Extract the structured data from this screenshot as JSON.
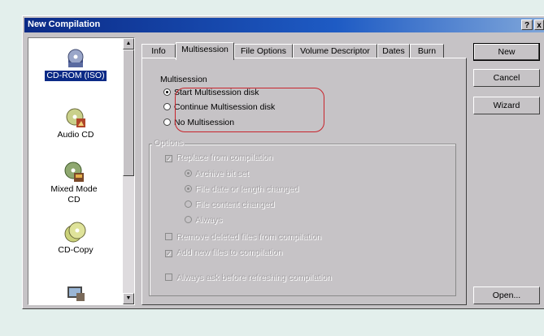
{
  "window": {
    "title": "New Compilation"
  },
  "titlebar_buttons": {
    "help": "?",
    "close": "x"
  },
  "compilation_types": [
    {
      "label": "CD-ROM (ISO)",
      "icon": "cd-rom-iso-icon",
      "selected": true
    },
    {
      "label": "Audio CD",
      "icon": "audio-cd-icon"
    },
    {
      "label": "Mixed Mode CD",
      "icon": "mixed-mode-cd-icon"
    },
    {
      "label": "CD-Copy",
      "icon": "cd-copy-icon"
    },
    {
      "label": "",
      "icon": "video-cd-icon"
    }
  ],
  "tabs": [
    {
      "label": "Info"
    },
    {
      "label": "Multisession",
      "active": true
    },
    {
      "label": "File Options"
    },
    {
      "label": "Volume Descriptor"
    },
    {
      "label": "Dates"
    },
    {
      "label": "Burn"
    }
  ],
  "multisession": {
    "group_label": "Multisession",
    "options": [
      {
        "label": "Start Multisession disk",
        "checked": true
      },
      {
        "label": "Continue Multisession disk",
        "checked": false
      },
      {
        "label": "No Multisession",
        "checked": false
      }
    ]
  },
  "options": {
    "group_label": "Options",
    "replace_label": "Replace from compilation",
    "sub_options": [
      {
        "label": "Archive bit set",
        "checked": true
      },
      {
        "label": "File date or length changed",
        "checked": true
      },
      {
        "label": "File content changed",
        "checked": false
      },
      {
        "label": "Always",
        "checked": false
      }
    ],
    "remove_label": "Remove deleted files from compilation",
    "add_new_label": "Add new files to compilation",
    "always_ask_label": "Always ask before refreshing compilation"
  },
  "buttons": {
    "new": "New",
    "cancel": "Cancel",
    "wizard": "Wizard",
    "open": "Open..."
  },
  "colors": {
    "dialog": "#c6c3c6",
    "title": "#0b2a86",
    "highlight": "#c8242c",
    "page": "#e3efec"
  }
}
